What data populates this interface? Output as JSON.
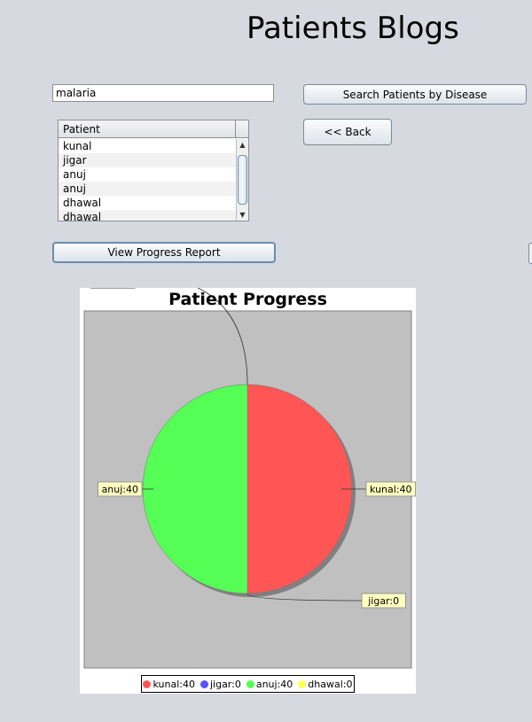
{
  "app": {
    "title": "Patients Blogs"
  },
  "search": {
    "value": "malaria",
    "button_label": "Search Patients by Disease"
  },
  "nav": {
    "back_label": "<< Back"
  },
  "patient_list": {
    "header": "Patient",
    "items": [
      "kunal",
      "jigar",
      "anuj",
      "anuj",
      "dhawal",
      "dhawal"
    ]
  },
  "actions": {
    "view_report_label": "View Progress Report"
  },
  "chart_data": {
    "type": "pie",
    "title": "Patient Progress",
    "slices": [
      {
        "name": "kunal",
        "value": 40,
        "color": "#ff5555",
        "label": "kunal:40"
      },
      {
        "name": "jigar",
        "value": 0,
        "color": "#5555ff",
        "label": "jigar:0"
      },
      {
        "name": "anuj",
        "value": 40,
        "color": "#55ff55",
        "label": "anuj:40"
      },
      {
        "name": "dhawal",
        "value": 0,
        "color": "#ffff55",
        "label": "dhawal:0",
        "label_lines": [
          "dhawal:",
          "0"
        ]
      }
    ],
    "legend_position": "bottom",
    "plot_background": "#c0c0c0"
  }
}
